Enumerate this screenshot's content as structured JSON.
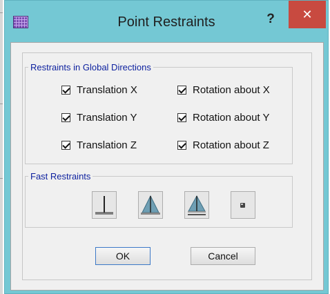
{
  "dialog": {
    "title": "Point Restraints",
    "help_label": "?",
    "close_label": "✕"
  },
  "global_group": {
    "legend": "Restraints in Global Directions",
    "items": [
      {
        "label": "Translation X",
        "checked": true
      },
      {
        "label": "Rotation about X",
        "checked": true
      },
      {
        "label": "Translation Y",
        "checked": true
      },
      {
        "label": "Rotation about Y",
        "checked": true
      },
      {
        "label": "Translation Z",
        "checked": true
      },
      {
        "label": "Rotation about Z",
        "checked": true
      }
    ]
  },
  "fast_group": {
    "legend": "Fast Restraints",
    "buttons": [
      {
        "icon": "fixed-support-icon"
      },
      {
        "icon": "pinned-support-icon"
      },
      {
        "icon": "roller-support-icon"
      },
      {
        "icon": "free-joint-icon"
      }
    ]
  },
  "buttons": {
    "ok": "OK",
    "cancel": "Cancel"
  },
  "colors": {
    "frame": "#74c8d4",
    "close": "#c84a40",
    "legend_text": "#0b1f9e",
    "cone": "#6f9fb4"
  }
}
